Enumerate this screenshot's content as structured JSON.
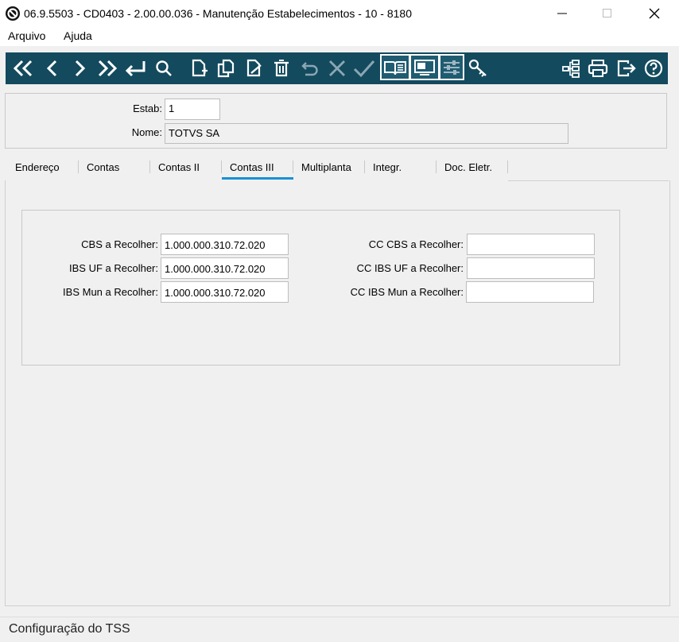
{
  "window": {
    "title": "06.9.5503 - CD0403 - 2.00.00.036 - Manutenção Estabelecimentos - 10 - 8180",
    "icons": [
      "app-logo-icon",
      "minimize-icon",
      "maximize-icon",
      "close-icon"
    ]
  },
  "menu": {
    "items": [
      "Arquivo",
      "Ajuda"
    ]
  },
  "toolbar": {
    "bg_color": "#134a5e",
    "buttons": [
      "first-record-icon",
      "previous-record-icon",
      "next-record-icon",
      "last-record-icon",
      "go-to-icon",
      "search-icon",
      "new-record-icon",
      "copy-record-icon",
      "edit-record-icon",
      "delete-icon",
      "undo-icon",
      "cancel-icon",
      "confirm-icon",
      "book-icon",
      "screen-icon",
      "settings-sliders-icon",
      "keys-icon",
      "tree-icon",
      "print-icon",
      "exit-icon",
      "help-icon"
    ]
  },
  "header": {
    "estab_label": "Estab:",
    "estab_value": "1",
    "nome_label": "Nome:",
    "nome_value": "TOTVS SA"
  },
  "tabs": {
    "items": [
      "Endereço",
      "Contas",
      "Contas II",
      "Contas III",
      "Multiplanta",
      "Integr.",
      "Doc. Eletr."
    ],
    "active": "Contas III",
    "accent_color": "#1a8fd6"
  },
  "contas_iii": {
    "left": [
      {
        "label": "CBS a Recolher:",
        "value": "1.000.000.310.72.020"
      },
      {
        "label": "IBS UF a Recolher:",
        "value": "1.000.000.310.72.020"
      },
      {
        "label": "IBS Mun a Recolher:",
        "value": "1.000.000.310.72.020"
      }
    ],
    "right": [
      {
        "label": "CC CBS a Recolher:",
        "value": ""
      },
      {
        "label": "CC IBS UF a Recolher:",
        "value": ""
      },
      {
        "label": "CC IBS Mun a Recolher:",
        "value": ""
      }
    ]
  },
  "status": {
    "text": "Configuração do TSS"
  }
}
